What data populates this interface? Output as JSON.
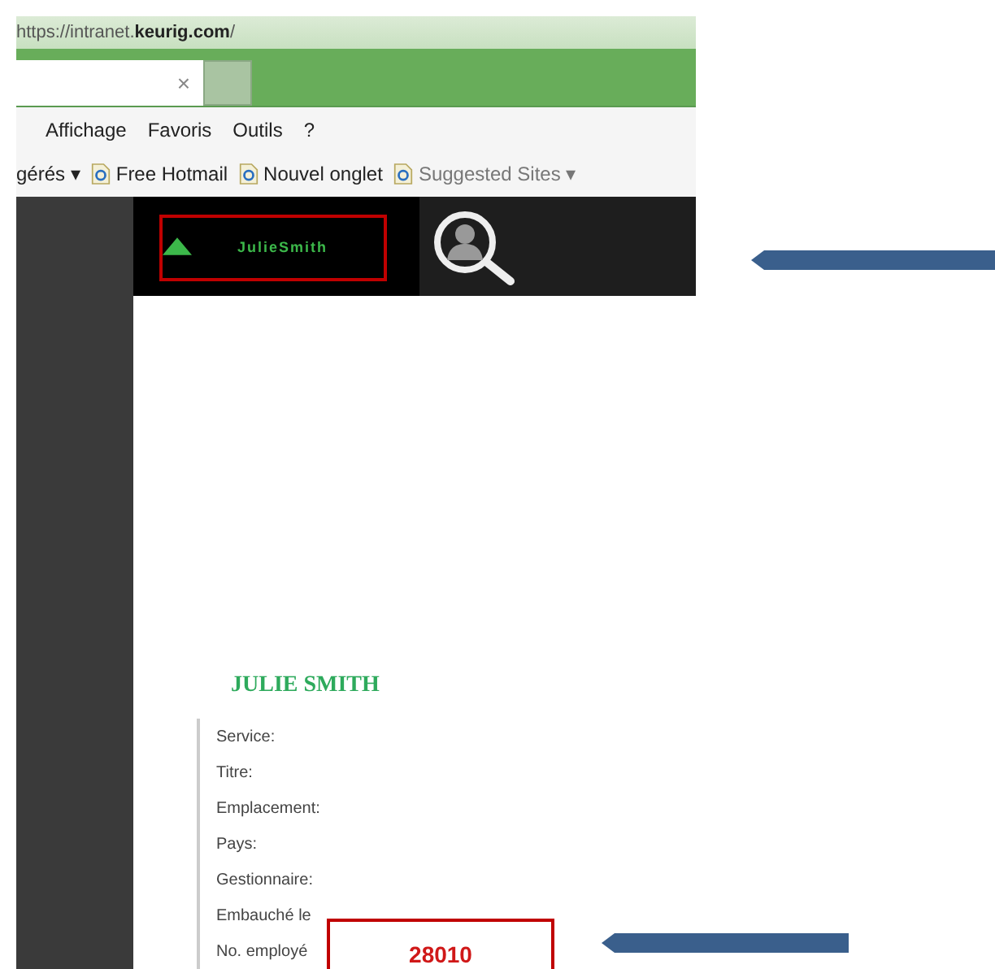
{
  "address_bar": {
    "url_prefix": "https://intranet.",
    "url_domain": "keurig.com",
    "url_suffix": "/"
  },
  "tab": {
    "close": "×"
  },
  "menu": [
    "Affichage",
    "Favoris",
    "Outils",
    "?"
  ],
  "favorites_bar": [
    {
      "label": "gérés ▾",
      "kind": "text"
    },
    {
      "label": "Free Hotmail",
      "kind": "link"
    },
    {
      "label": "Nouvel onglet",
      "kind": "link"
    },
    {
      "label": "Suggested Sites ▾",
      "kind": "link-muted"
    }
  ],
  "header": {
    "user": "JulieSmith"
  },
  "profile": {
    "name": "JULIE SMITH",
    "fields": [
      {
        "label": "Service:"
      },
      {
        "label": "Titre:"
      },
      {
        "label": "Emplacement:"
      },
      {
        "label": "Pays:"
      },
      {
        "label": "Gestionnaire:"
      },
      {
        "label": "Embauché le"
      },
      {
        "label": "No. employé",
        "value": "28010"
      }
    ]
  }
}
